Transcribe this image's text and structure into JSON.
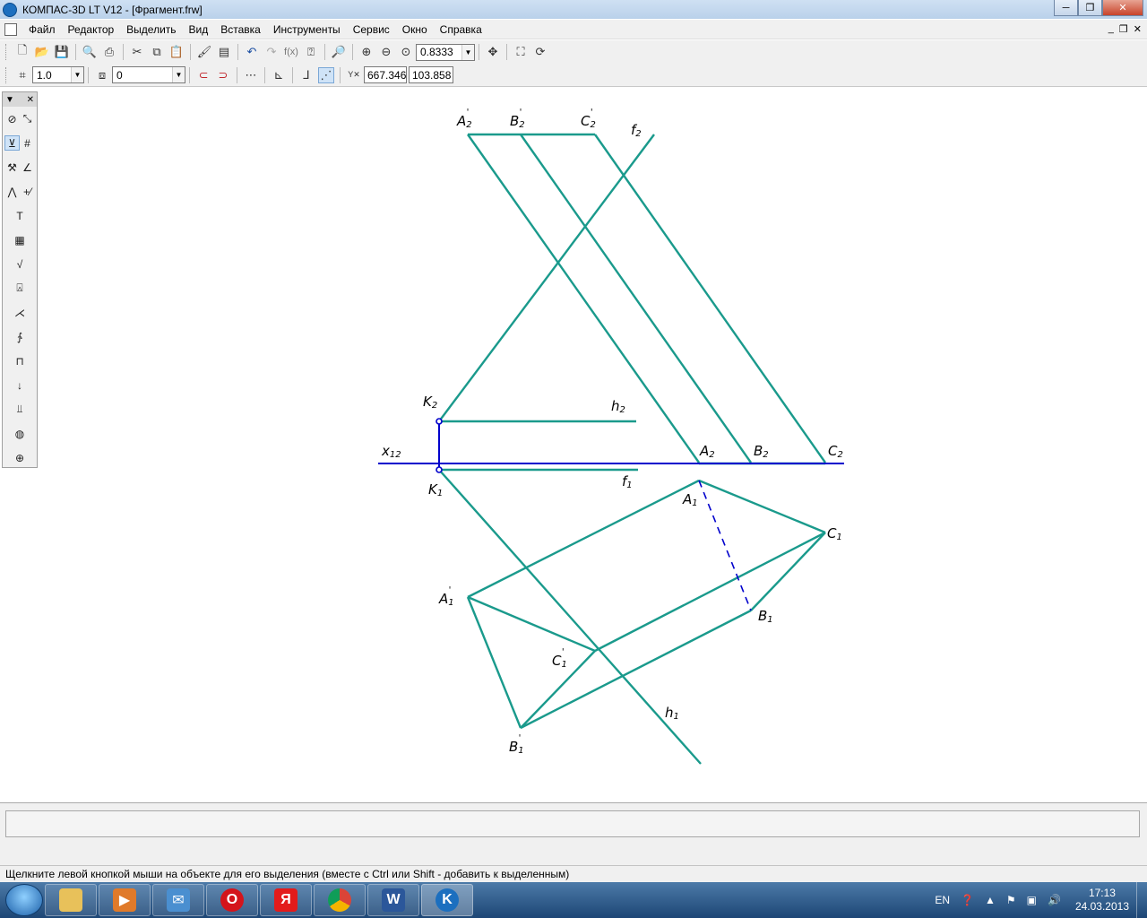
{
  "window": {
    "title": "КОМПАС-3D LT V12 - [Фрагмент.frw]",
    "minimize": "─",
    "maximize": "❐",
    "close": "✕"
  },
  "menu": {
    "items": [
      "Файл",
      "Редактор",
      "Выделить",
      "Вид",
      "Вставка",
      "Инструменты",
      "Сервис",
      "Окно",
      "Справка"
    ],
    "mdi_minimize": "_",
    "mdi_restore": "❐",
    "mdi_close": "✕"
  },
  "toolbar1": {
    "zoom_value": "0.8333"
  },
  "toolbar2": {
    "line_scale": "1.0",
    "layer": "0",
    "coord_x": "667.346",
    "coord_y": "103.858"
  },
  "drawing": {
    "colors": {
      "teal": "#1a9a8c",
      "blue": "#0000cc"
    },
    "labels": {
      "A2p": "A",
      "A2p_sub": "2",
      "A2p_prime": "'",
      "B2p": "B",
      "B2p_sub": "2",
      "B2p_prime": "'",
      "C2p": "C",
      "C2p_sub": "2",
      "C2p_prime": "'",
      "f2": "f",
      "f2_sub": "2",
      "K2": "K",
      "K2_sub": "2",
      "h2": "h",
      "h2_sub": "2",
      "x12": "x",
      "x12_sub": "12",
      "A2": "A",
      "A2_sub": "2",
      "B2": "B",
      "B2_sub": "2",
      "C2": "C",
      "C2_sub": "2",
      "K1": "K",
      "K1_sub": "1",
      "f1": "f",
      "f1_sub": "1",
      "A1": "A",
      "A1_sub": "1",
      "C1": "C",
      "C1_sub": "1",
      "A1p": "A",
      "A1p_sub": "1",
      "A1p_prime": "'",
      "B1": "B",
      "B1_sub": "1",
      "C1p": "C",
      "C1p_sub": "1",
      "C1p_prime": "'",
      "h1": "h",
      "h1_sub": "1",
      "B1p": "B",
      "B1p_sub": "1",
      "B1p_prime": "'"
    }
  },
  "status": {
    "hint": "Щелкните левой кнопкой мыши на объекте для его выделения (вместе с Ctrl или Shift - добавить к выделенным)"
  },
  "taskbar": {
    "lang": "EN",
    "time": "17:13",
    "date": "24.03.2013",
    "opera": "O",
    "yandex": "Я",
    "word": "W",
    "kompas": "K"
  }
}
